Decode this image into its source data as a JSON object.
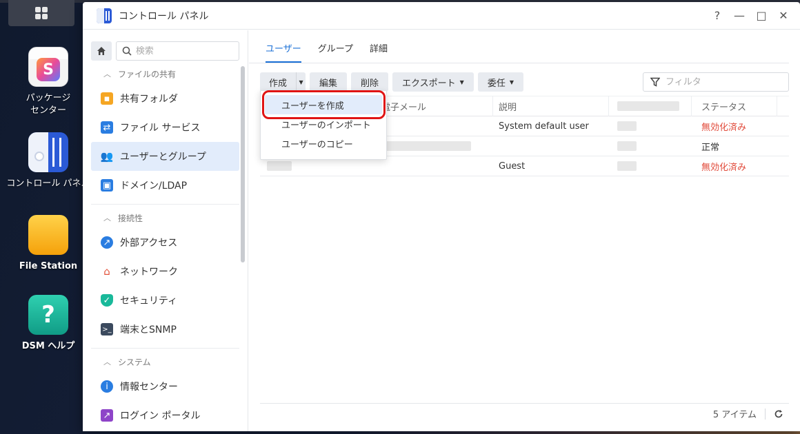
{
  "desktop": {
    "icons": [
      {
        "label": "パッケージ\nセンター",
        "icon": "package-center-icon"
      },
      {
        "label": "コントロール パネル",
        "icon": "control-panel-icon"
      },
      {
        "label": "File Station",
        "icon": "file-station-icon"
      },
      {
        "label": "DSM ヘルプ",
        "icon": "help-icon"
      }
    ]
  },
  "window": {
    "title": "コントロール パネル",
    "controls": {
      "help": "?",
      "minimize": "—",
      "maximize": "□",
      "close": "✕"
    }
  },
  "sidebar": {
    "search_placeholder": "検索",
    "sections": [
      {
        "label": "ファイルの共有",
        "items": [
          "共有フォルダ",
          "ファイル サービス",
          "ユーザーとグループ",
          "ドメイン/LDAP"
        ]
      },
      {
        "label": "接続性",
        "items": [
          "外部アクセス",
          "ネットワーク",
          "セキュリティ",
          "端末とSNMP"
        ]
      },
      {
        "label": "システム",
        "items": [
          "情報センター",
          "ログイン ポータル"
        ]
      }
    ]
  },
  "tabs": [
    "ユーザー",
    "グループ",
    "詳細"
  ],
  "toolbar": {
    "create": "作成",
    "edit": "編集",
    "delete": "削除",
    "export": "エクスポート",
    "delegate": "委任",
    "filter_placeholder": "フィルタ"
  },
  "dropdown": {
    "items": [
      "ユーザーを作成",
      "ユーザーのインポート",
      "ユーザーのコピー"
    ]
  },
  "table": {
    "columns": [
      "",
      "電子メール",
      "説明",
      "",
      "ステータス"
    ],
    "rows": [
      {
        "description": "System default user",
        "status": "無効化済み"
      },
      {
        "description": "",
        "status": "正常"
      },
      {
        "description": "Guest",
        "status": "無効化済み"
      }
    ]
  },
  "footer": {
    "count": "5 アイテム"
  },
  "colors": {
    "accent": "#1a6fd6",
    "disabled": "#e14b3b",
    "highlight_ring": "#e01414"
  }
}
